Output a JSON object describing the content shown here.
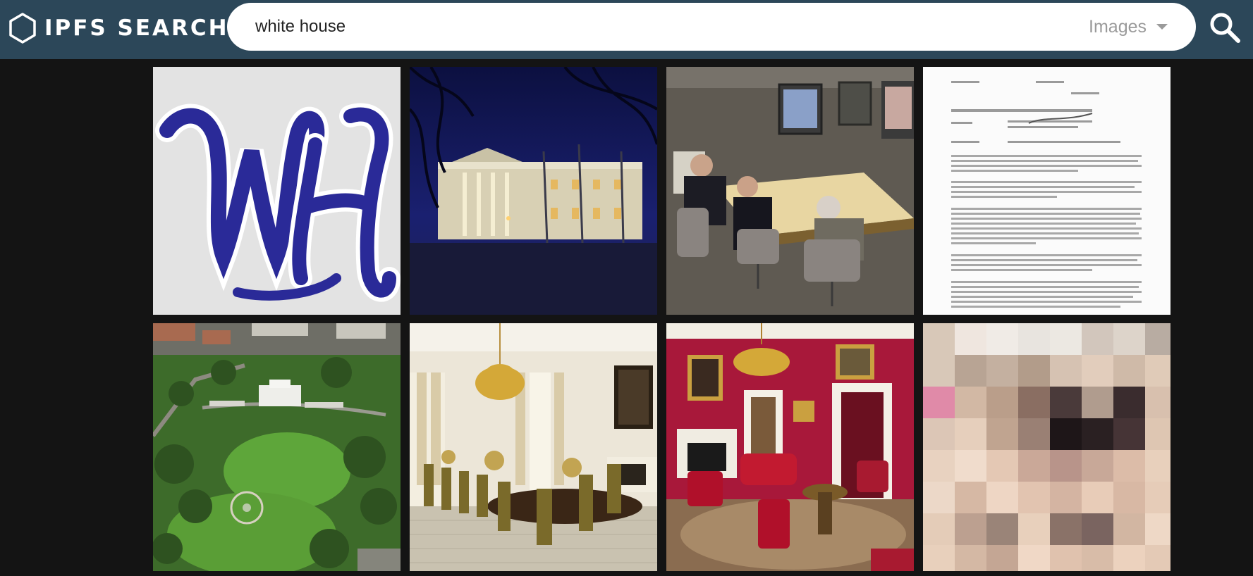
{
  "app": {
    "name": "IPFS SEARCH",
    "logo_icon": "hexagon-icon"
  },
  "search": {
    "query": "white house",
    "type_selected": "Images",
    "search_icon": "magnifier-icon"
  },
  "colors": {
    "header_bg": "#2c4759",
    "page_bg": "#141414",
    "search_box": "#ffffff",
    "select_text": "#9a9a9a"
  },
  "results": [
    {
      "id": 1,
      "content": "WH monogram logo"
    },
    {
      "id": 2,
      "content": "White House at night"
    },
    {
      "id": 3,
      "content": "Meeting room"
    },
    {
      "id": 4,
      "content": "Document memo"
    },
    {
      "id": 5,
      "content": "Aerial view"
    },
    {
      "id": 6,
      "content": "State dining room"
    },
    {
      "id": 7,
      "content": "Red room"
    },
    {
      "id": 8,
      "content": "Pixelated image"
    }
  ]
}
